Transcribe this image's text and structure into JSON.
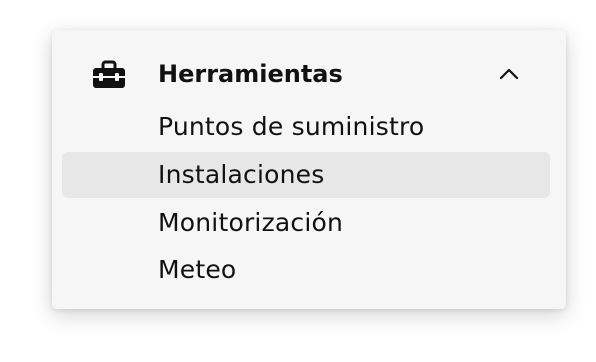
{
  "menu": {
    "header": {
      "title": "Herramientas",
      "icon": "toolbox-icon",
      "toggle_icon": "chevron-up-icon",
      "expanded": true
    },
    "items": [
      {
        "label": "Puntos de suministro",
        "active": false
      },
      {
        "label": "Instalaciones",
        "active": true
      },
      {
        "label": "Monitorización",
        "active": false
      },
      {
        "label": "Meteo",
        "active": false
      }
    ]
  },
  "colors": {
    "card_background": "#f6f6f6",
    "active_item_background": "#e7e7e7",
    "text": "#111111"
  }
}
